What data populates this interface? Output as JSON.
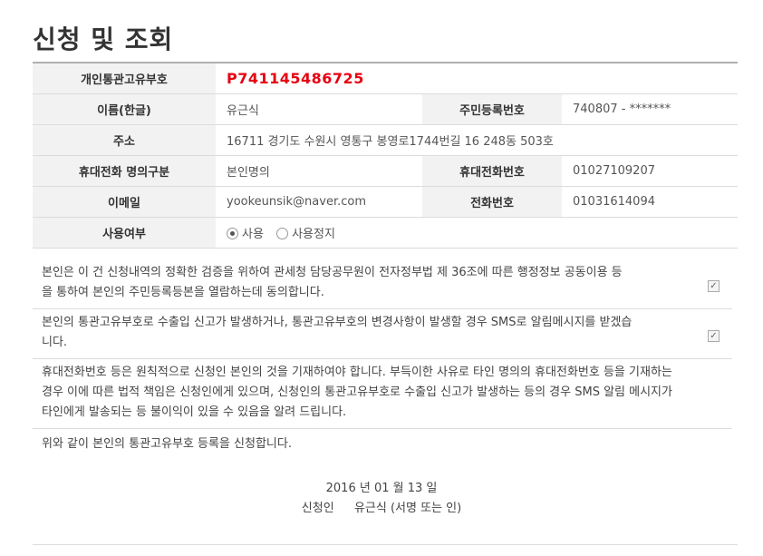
{
  "page_title": "신청 및 조회",
  "rows": {
    "personal_code": {
      "label": "개인통관고유부호",
      "value": "P741145486725"
    },
    "name": {
      "label": "이름(한글)",
      "value": "유근식"
    },
    "resident_no": {
      "label": "주민등록번호",
      "value": "740807 - *******"
    },
    "address": {
      "label": "주소",
      "value": "16711 경기도 수원시 영통구 봉영로1744번길 16 248동 503호"
    },
    "phone_owner": {
      "label": "휴대전화 명의구분",
      "value": "본인명의"
    },
    "mobile": {
      "label": "휴대전화번호",
      "value": "01027109207"
    },
    "email": {
      "label": "이메일",
      "value": "yookeunsik@naver.com"
    },
    "phone": {
      "label": "전화번호",
      "value": "01031614094"
    },
    "usage": {
      "label": "사용여부",
      "option_use": "사용",
      "option_stop": "사용정지",
      "selected": "사용"
    }
  },
  "agreements": [
    {
      "line1": "본인은 이 건 신청내역의 정확한 검증을 위하여 관세청 담당공무원이 전자정부법 제 36조에 따른 행정정보 공동이용 등",
      "line2": "을 통하여 본인의 주민등록등본을 열람하는데 동의합니다.",
      "checked": true
    },
    {
      "line1": "본인의 통관고유부호로 수출입 신고가 발생하거나, 통관고유부호의 변경사항이 발생할 경우 SMS로 알림메시지를 받겠습",
      "line2": "니다.",
      "checked": true
    }
  ],
  "notice": {
    "line1": "휴대전화번호 등은 원칙적으로 신청인 본인의 것을 기재하여야 합니다. 부득이한 사유로 타인 명의의 휴대전화번호 등을 기재하는",
    "line2": "경우 이에 따른 법적 책임은 신청인에게 있으며, 신청인의 통관고유부호로 수출입 신고가 발생하는 등의 경우 SMS 알림 메시지가",
    "line3": "타인에게 발송되는 등 불이익이 있을 수 있음을 알려 드립니다."
  },
  "statement": "위와 같이 본인의 통관고유부호 등록을 신청합니다.",
  "date": "2016 년 01 월 13 일",
  "applicant": {
    "label": "신청인",
    "name": "유근식",
    "note": "(서명 또는 인)"
  }
}
